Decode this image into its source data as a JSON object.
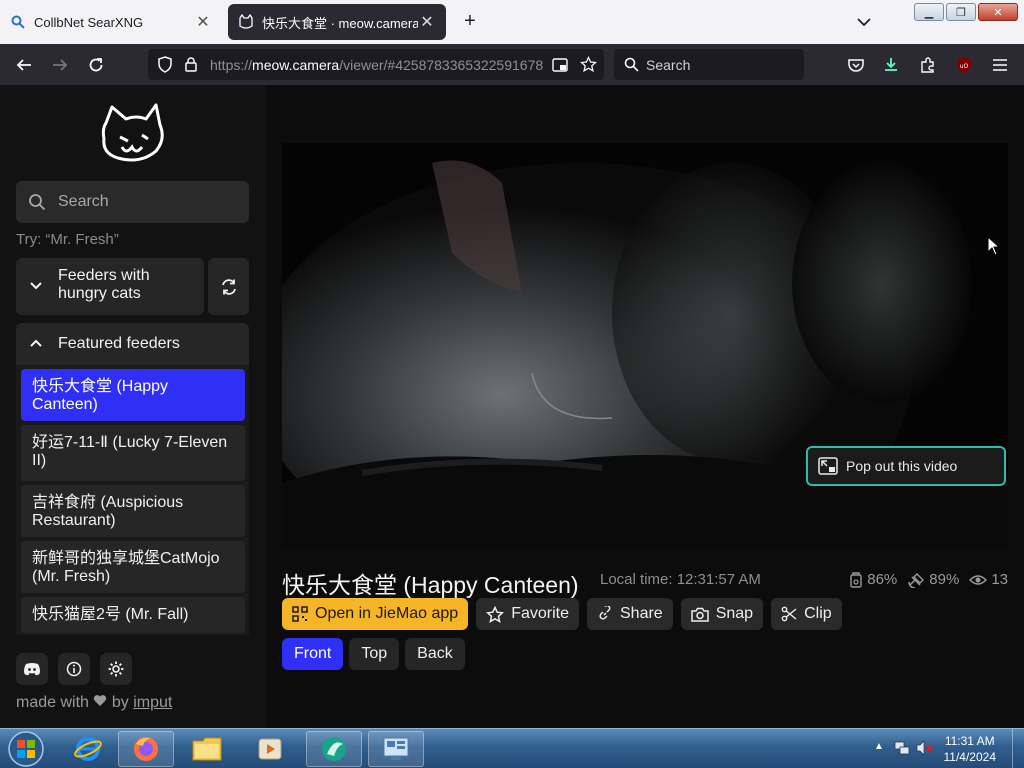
{
  "browser": {
    "tabs": [
      {
        "label": "CollbNet SearXNG",
        "active": false
      },
      {
        "label": "快乐大食堂 · meow.camera",
        "active": true
      }
    ],
    "url": {
      "prefix": "https://",
      "host": "meow.camera",
      "path": "/viewer/#4258783365322591678"
    },
    "search_placeholder": "Search"
  },
  "sidebar": {
    "search_placeholder": "Search",
    "hint": "Try: “Mr. Fresh”",
    "group_label": "Feeders with hungry cats",
    "featured_label": "Featured feeders",
    "feeders": [
      {
        "label": "快乐大食堂 (Happy Canteen)",
        "active": true
      },
      {
        "label": "好运7-11-Ⅱ (Lucky 7-Eleven II)",
        "active": false
      },
      {
        "label": "吉祥食府 (Auspicious Restaurant)",
        "active": false
      },
      {
        "label": "新鲜哥的独享城堡CatMojo (Mr. Fresh)",
        "active": false
      },
      {
        "label": "快乐猫屋2号 (Mr. Fall)",
        "active": false
      }
    ],
    "footer": {
      "made_with": "made with",
      "by": "by",
      "author": "imput"
    }
  },
  "viewer": {
    "popout_label": "Pop out this video",
    "title": "快乐大食堂 (Happy Canteen)",
    "local_time": "Local time: 12:31:57 AM",
    "stats": {
      "food": "86%",
      "battery": "89%",
      "viewers": "13"
    },
    "actions": [
      "Open in JieMao app",
      "Favorite",
      "Share",
      "Snap",
      "Clip"
    ],
    "views": [
      {
        "label": "Front",
        "active": true
      },
      {
        "label": "Top",
        "active": false
      },
      {
        "label": "Back",
        "active": false
      }
    ]
  },
  "taskbar": {
    "time": "11:31 AM",
    "date": "11/4/2024"
  },
  "colors": {
    "accent": "#2f2ff5",
    "primary_button": "#f6b427",
    "popout_border": "#2fbab0"
  }
}
